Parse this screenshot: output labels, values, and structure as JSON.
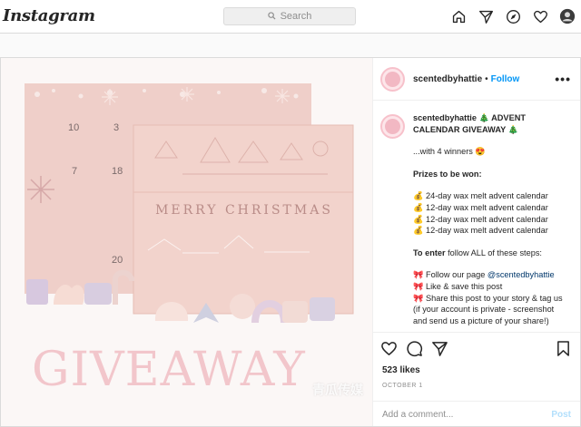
{
  "app": {
    "logo_text": "Instagram"
  },
  "search": {
    "placeholder": "Search"
  },
  "nav": {
    "icons": [
      "home-icon",
      "direct-icon",
      "explore-icon",
      "activity-heart-icon",
      "profile-avatar"
    ]
  },
  "post": {
    "username": "scentedbyhattie",
    "follow_label": "Follow",
    "more_label": "•••",
    "image": {
      "overlay_text": "GIVEAWAY",
      "front_box_text": "MERRY CHRISTMAS",
      "calendar_numbers": [
        "10",
        "3",
        "7",
        "18",
        "20"
      ],
      "watermark": "青瓜传媒"
    },
    "caption": {
      "title": "🎄 ADVENT CALENDAR GIVEAWAY 🎄",
      "line_winners": "...with 4 winners 😍",
      "prizes_heading": "Prizes to be won:",
      "prizes": [
        "💰 24-day wax melt advent calendar",
        "💰 12-day wax melt advent calendar",
        "💰 12-day wax melt advent calendar",
        "💰 12-day wax melt advent calendar"
      ],
      "enter_bold": "To enter",
      "enter_rest": " follow ALL of these steps:",
      "step1_pre": "🎀 Follow our page ",
      "step1_link": "@scentedbyhattie",
      "step2": "🎀 Like & save this post",
      "step3": "🎀 Share this post to your story & tag us (if your account is private - screenshot and send us a picture of your share!)"
    },
    "likes": "523 likes",
    "date": "OCTOBER 1",
    "comment_placeholder": "Add a comment...",
    "post_button": "Post"
  },
  "colors": {
    "accent": "#0095f6",
    "pink": "#f2c6cb",
    "box": "#f0cfc8"
  }
}
